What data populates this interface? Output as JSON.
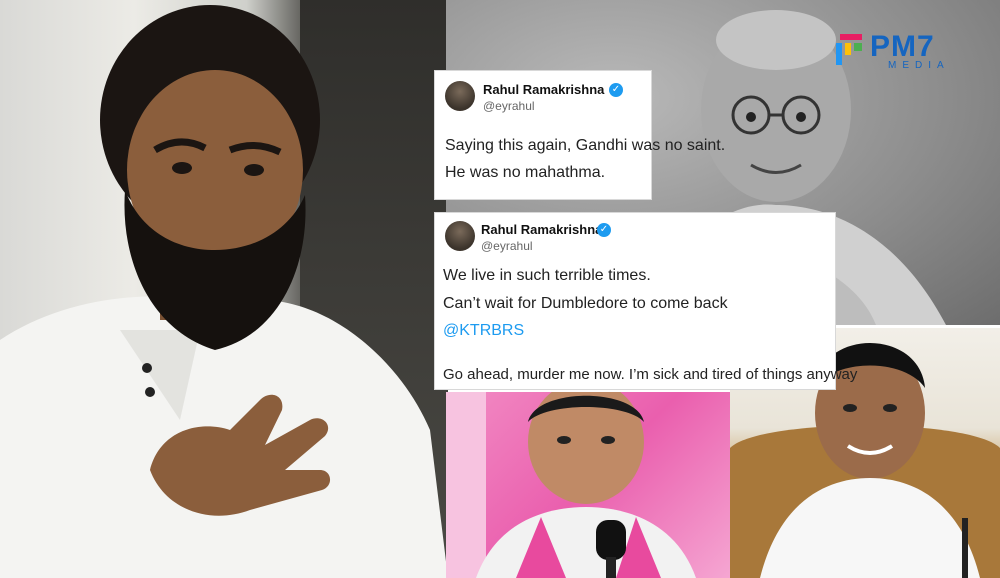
{
  "logo": {
    "brand": "PM7",
    "sub": "MEDIA",
    "color": "#1565c0"
  },
  "photos": {
    "left": "man-with-beard-gesturing-photo",
    "gandhi": "mahatma-gandhi-portrait-photo",
    "ktr": "man-speaking-at-microphone-photo",
    "revanth": "man-smiling-in-white-shirt-photo"
  },
  "tweet1": {
    "name": "Rahul Ramakrishna",
    "handle": "@eyrahul",
    "lines": [
      "Saying this again, Gandhi was no saint.",
      "He was no mahathma."
    ]
  },
  "tweet2": {
    "name": "Rahul Ramakrishna",
    "handle": "@eyrahul",
    "lines": [
      "We live in such terrible times.",
      "Can’t wait for Dumbledore to come back"
    ],
    "mention": "@KTRBRS",
    "closing": "Go ahead, murder me now. I’m sick and tired of things anyway"
  },
  "colors": {
    "verified": "#1d9bf0",
    "mention": "#1d9bf0",
    "pink_bg": "#ea5fae"
  }
}
